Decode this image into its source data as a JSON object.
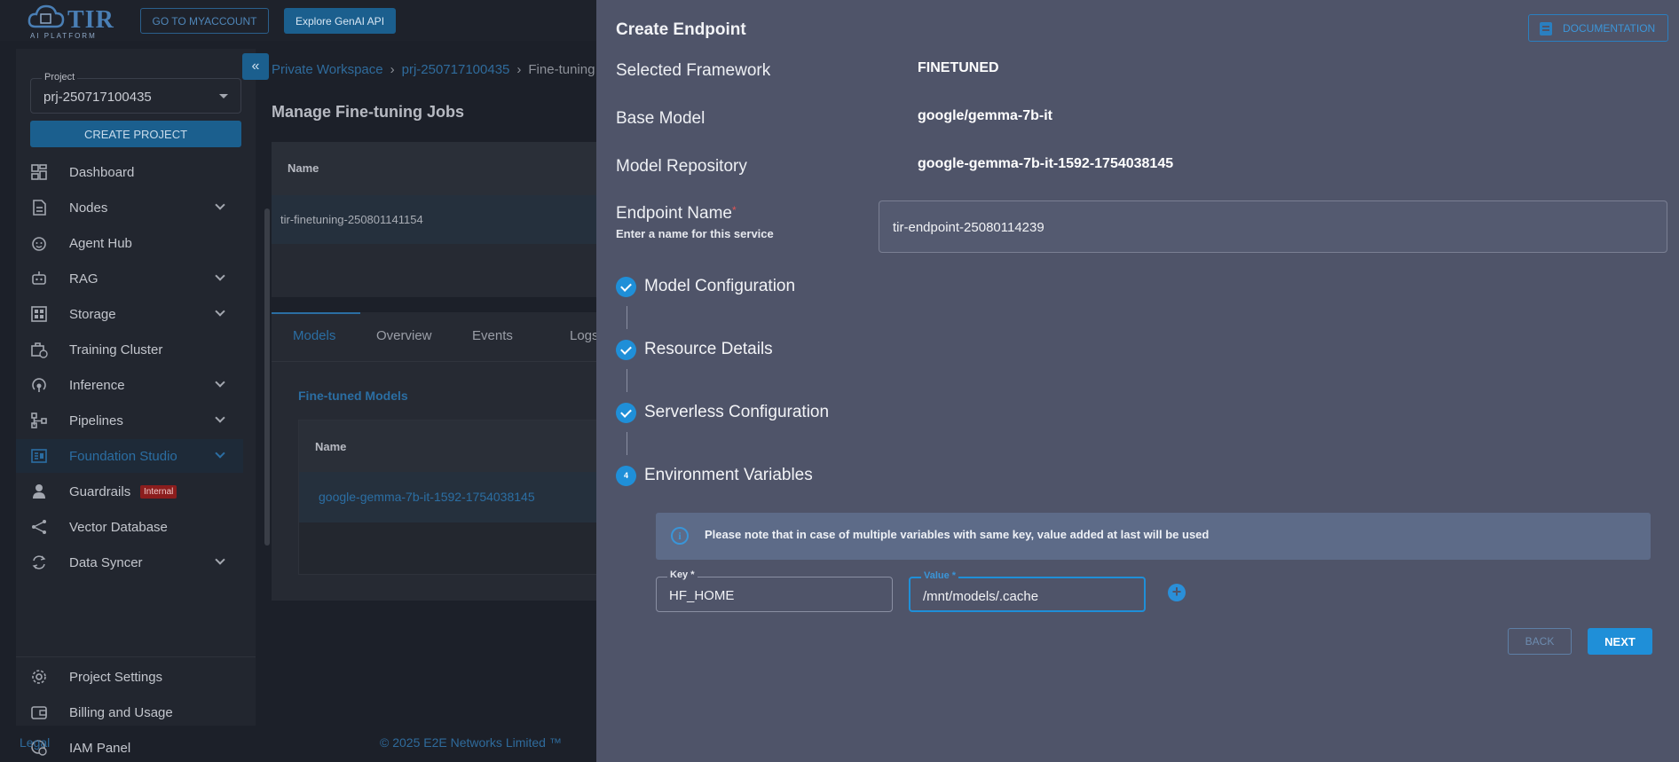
{
  "header": {
    "logo_text": "TIR",
    "logo_subtext": "AI PLATFORM",
    "go_to_account_label": "GO TO MYACCOUNT",
    "explore_genai_label": "Explore GenAI API"
  },
  "sidebar": {
    "project_label": "Project",
    "project_value": "prj-250717100435",
    "create_project_label": "CREATE PROJECT",
    "collapse_icon": "«",
    "items": [
      {
        "label": "Dashboard",
        "icon": "dashboard-icon",
        "expandable": false
      },
      {
        "label": "Nodes",
        "icon": "nodes-icon",
        "expandable": true
      },
      {
        "label": "Agent Hub",
        "icon": "agent-hub-icon",
        "expandable": false
      },
      {
        "label": "RAG",
        "icon": "robot-icon",
        "expandable": true
      },
      {
        "label": "Storage",
        "icon": "storage-icon",
        "expandable": true
      },
      {
        "label": "Training Cluster",
        "icon": "training-cluster-icon",
        "expandable": false
      },
      {
        "label": "Inference",
        "icon": "inference-icon",
        "expandable": true
      },
      {
        "label": "Pipelines",
        "icon": "pipelines-icon",
        "expandable": true
      },
      {
        "label": "Foundation Studio",
        "icon": "foundation-studio-icon",
        "expandable": true,
        "active": true
      },
      {
        "label": "Guardrails",
        "icon": "guardrails-icon",
        "expandable": false,
        "badge": "Internal"
      },
      {
        "label": "Vector Database",
        "icon": "vector-db-icon",
        "expandable": false
      },
      {
        "label": "Data Syncer",
        "icon": "sync-icon",
        "expandable": true
      }
    ],
    "bottom_items": [
      {
        "label": "Project Settings",
        "icon": "gear-icon"
      },
      {
        "label": "Billing and Usage",
        "icon": "wallet-icon"
      },
      {
        "label": "IAM Panel",
        "icon": "iam-icon"
      }
    ]
  },
  "footer": {
    "legal": "Legal",
    "copyright": "© 2025 E2E Networks Limited ™"
  },
  "main": {
    "breadcrumb": [
      "Private Workspace",
      "prj-250717100435",
      "Fine-tuning"
    ],
    "title": "Manage Fine-tuning Jobs",
    "jobs_table": {
      "header": "Name",
      "rows": [
        "tir-finetuning-250801141154"
      ]
    },
    "tabs": [
      "Models",
      "Overview",
      "Events",
      "Logs"
    ],
    "active_tab": "Models",
    "finetuned_models_title": "Fine-tuned Models",
    "models_table": {
      "header": "Name",
      "rows": [
        "google-gemma-7b-it-1592-1754038145"
      ]
    }
  },
  "drawer": {
    "title": "Create Endpoint",
    "documentation_label": "DOCUMENTATION",
    "selected_framework_label": "Selected Framework",
    "selected_framework_value": "FINETUNED",
    "base_model_label": "Base Model",
    "base_model_value": "google/gemma-7b-it",
    "model_repository_label": "Model Repository",
    "model_repository_value": "google-gemma-7b-it-1592-1754038145",
    "endpoint_name_label": "Endpoint Name",
    "endpoint_name_required": "*",
    "endpoint_name_hint": "Enter a name for this service",
    "endpoint_name_value": "tir-endpoint-25080114239",
    "steps": [
      {
        "label": "Model Configuration",
        "status": "done"
      },
      {
        "label": "Resource Details",
        "status": "done"
      },
      {
        "label": "Serverless Configuration",
        "status": "done"
      },
      {
        "label": "Environment Variables",
        "status": "active",
        "number": "4"
      }
    ],
    "info_text": "Please note that in case of multiple variables with same key, value added at last will be used",
    "env_key_label": "Key *",
    "env_key_value": "HF_HOME",
    "env_value_label": "Value *",
    "env_value_value": "/mnt/models/.cache",
    "back_label": "BACK",
    "next_label": "NEXT",
    "colors": {
      "accent": "#1f8fd8",
      "panel_bg": "#4f5469"
    }
  }
}
